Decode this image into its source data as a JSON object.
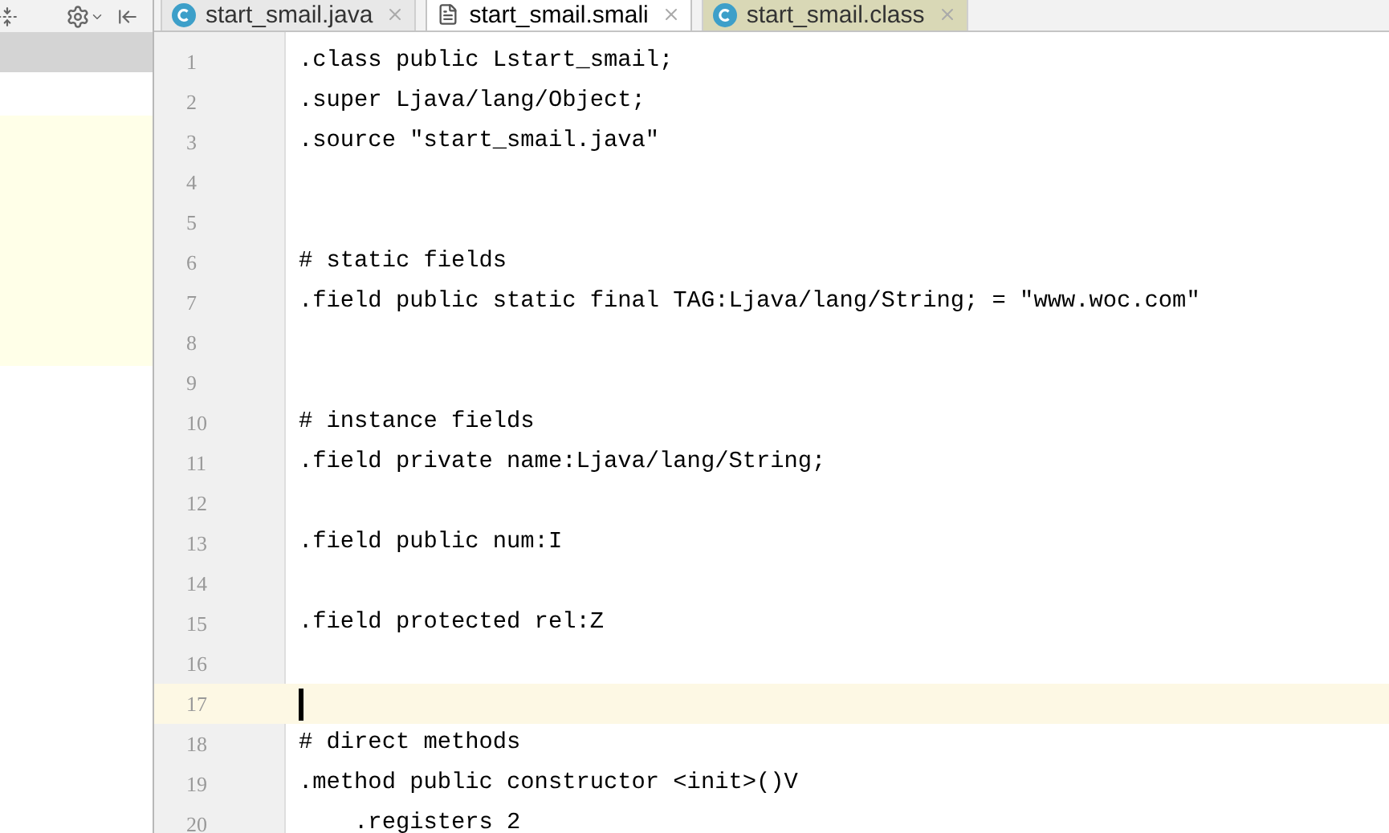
{
  "tabs": [
    {
      "label": "start_smail.java",
      "kind": "class",
      "selected": false,
      "color": "#e8e8e8"
    },
    {
      "label": "start_smail.smali",
      "kind": "file",
      "selected": true,
      "color": "#ffffff"
    },
    {
      "label": "start_smail.class",
      "kind": "class",
      "selected": false,
      "color": "#d9d8b6"
    }
  ],
  "editor": {
    "lines": [
      {
        "number": "1",
        "text": ".class public Lstart_smail;",
        "current": false
      },
      {
        "number": "2",
        "text": ".super Ljava/lang/Object;",
        "current": false
      },
      {
        "number": "3",
        "text": ".source \"start_smail.java\"",
        "current": false
      },
      {
        "number": "4",
        "current": false
      },
      {
        "number": "5",
        "current": false
      },
      {
        "number": "6",
        "text": "# static fields",
        "current": false
      },
      {
        "number": "7",
        "text": ".field public static final TAG:Ljava/lang/String; = \"www.woc.com\"",
        "current": false
      },
      {
        "number": "8",
        "current": false
      },
      {
        "number": "9",
        "current": false
      },
      {
        "number": "10",
        "text": "# instance fields",
        "current": false
      },
      {
        "number": "11",
        "text": ".field private name:Ljava/lang/String;",
        "current": false
      },
      {
        "number": "12",
        "current": false
      },
      {
        "number": "13",
        "text": ".field public num:I",
        "current": false
      },
      {
        "number": "14",
        "current": false
      },
      {
        "number": "15",
        "text": ".field protected rel:Z",
        "current": false
      },
      {
        "number": "16",
        "current": false
      },
      {
        "number": "17",
        "current": true
      },
      {
        "number": "18",
        "text": "# direct methods",
        "current": false
      },
      {
        "number": "19",
        "text": ".method public constructor <init>()V",
        "current": false
      },
      {
        "number": "20",
        "text": "    .registers 2",
        "current": false
      }
    ]
  }
}
